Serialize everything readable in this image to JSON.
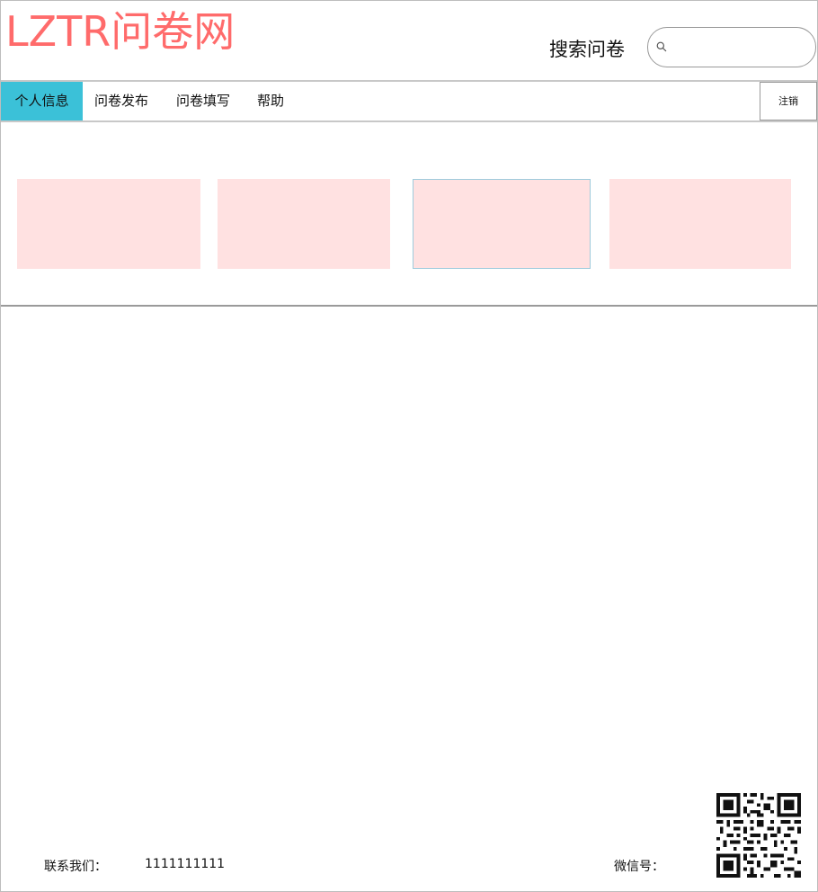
{
  "header": {
    "logo": "LZTR问卷网",
    "search_label": "搜索问卷",
    "search_value": ""
  },
  "nav": {
    "items": [
      {
        "label": "个人信息",
        "active": true
      },
      {
        "label": "问卷发布",
        "active": false
      },
      {
        "label": "问卷填写",
        "active": false
      },
      {
        "label": "帮助",
        "active": false
      }
    ],
    "logout_label": "注销"
  },
  "cards": {
    "fill_color": "#ffe1e1",
    "selected_border_color": "#9ecbdc"
  },
  "footer": {
    "contact_label": "联系我们：",
    "contact_value": "1111111111",
    "wechat_label": "微信号："
  },
  "colors": {
    "logo": "#ff6b6b",
    "nav_active": "#3bc1d8"
  },
  "icons": {
    "search": "search-icon",
    "qr": "qr-code-icon"
  }
}
